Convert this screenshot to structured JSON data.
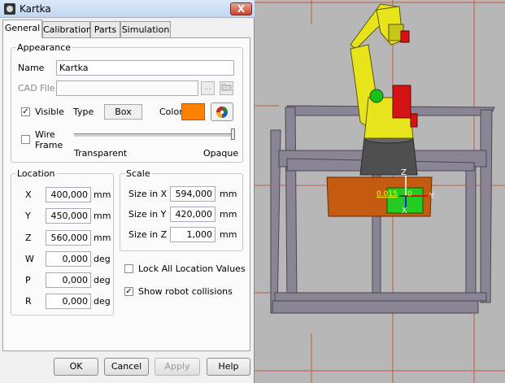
{
  "window": {
    "title": "Kartka",
    "close_glyph": "X"
  },
  "tabs": [
    {
      "label": "General",
      "active": true
    },
    {
      "label": "Calibration",
      "active": false
    },
    {
      "label": "Parts",
      "active": false
    },
    {
      "label": "Simulation",
      "active": false
    }
  ],
  "appearance": {
    "group_label": "Appearance",
    "name_label": "Name",
    "name_value": "Kartka",
    "cad_label": "CAD File",
    "cad_value": "",
    "visible_label": "Visible",
    "visible_checked": true,
    "type_label": "Type",
    "type_value": "Box",
    "color_label": "Color",
    "color_value": "#ff7f00",
    "wire_label_line1": "Wire",
    "wire_label_line2": "Frame",
    "wire_checked": false,
    "transparency_min_label": "Transparent",
    "transparency_max_label": "Opaque",
    "opacity": 1.0
  },
  "location": {
    "group_label": "Location",
    "fields": [
      {
        "label": "X",
        "value": "400,000",
        "unit": "mm"
      },
      {
        "label": "Y",
        "value": "450,000",
        "unit": "mm"
      },
      {
        "label": "Z",
        "value": "560,000",
        "unit": "mm"
      },
      {
        "label": "W",
        "value": "0,000",
        "unit": "deg"
      },
      {
        "label": "P",
        "value": "0,000",
        "unit": "deg"
      },
      {
        "label": "R",
        "value": "0,000",
        "unit": "deg"
      }
    ]
  },
  "scale": {
    "group_label": "Scale",
    "fields": [
      {
        "label": "Size in X",
        "value": "594,000",
        "unit": "mm"
      },
      {
        "label": "Size in Y",
        "value": "420,000",
        "unit": "mm"
      },
      {
        "label": "Size in Z",
        "value": "1,000",
        "unit": "mm"
      }
    ]
  },
  "options": {
    "lock_label": "Lock All Location Values",
    "lock_checked": false,
    "collisions_label": "Show robot collisions",
    "collisions_checked": true
  },
  "buttons": {
    "ok": "OK",
    "cancel": "Cancel",
    "apply": "Apply",
    "help": "Help"
  },
  "viewport": {
    "axis_x_label": "X",
    "axis_y_label": "Y",
    "axis_z_label": "Z",
    "readout_text": "0.015",
    "readout_text2": "0",
    "grid_color": "#c85a3c",
    "robot_color": "#e8e41c",
    "part_color": "#c55a11",
    "frame_color": "#8a8494"
  }
}
